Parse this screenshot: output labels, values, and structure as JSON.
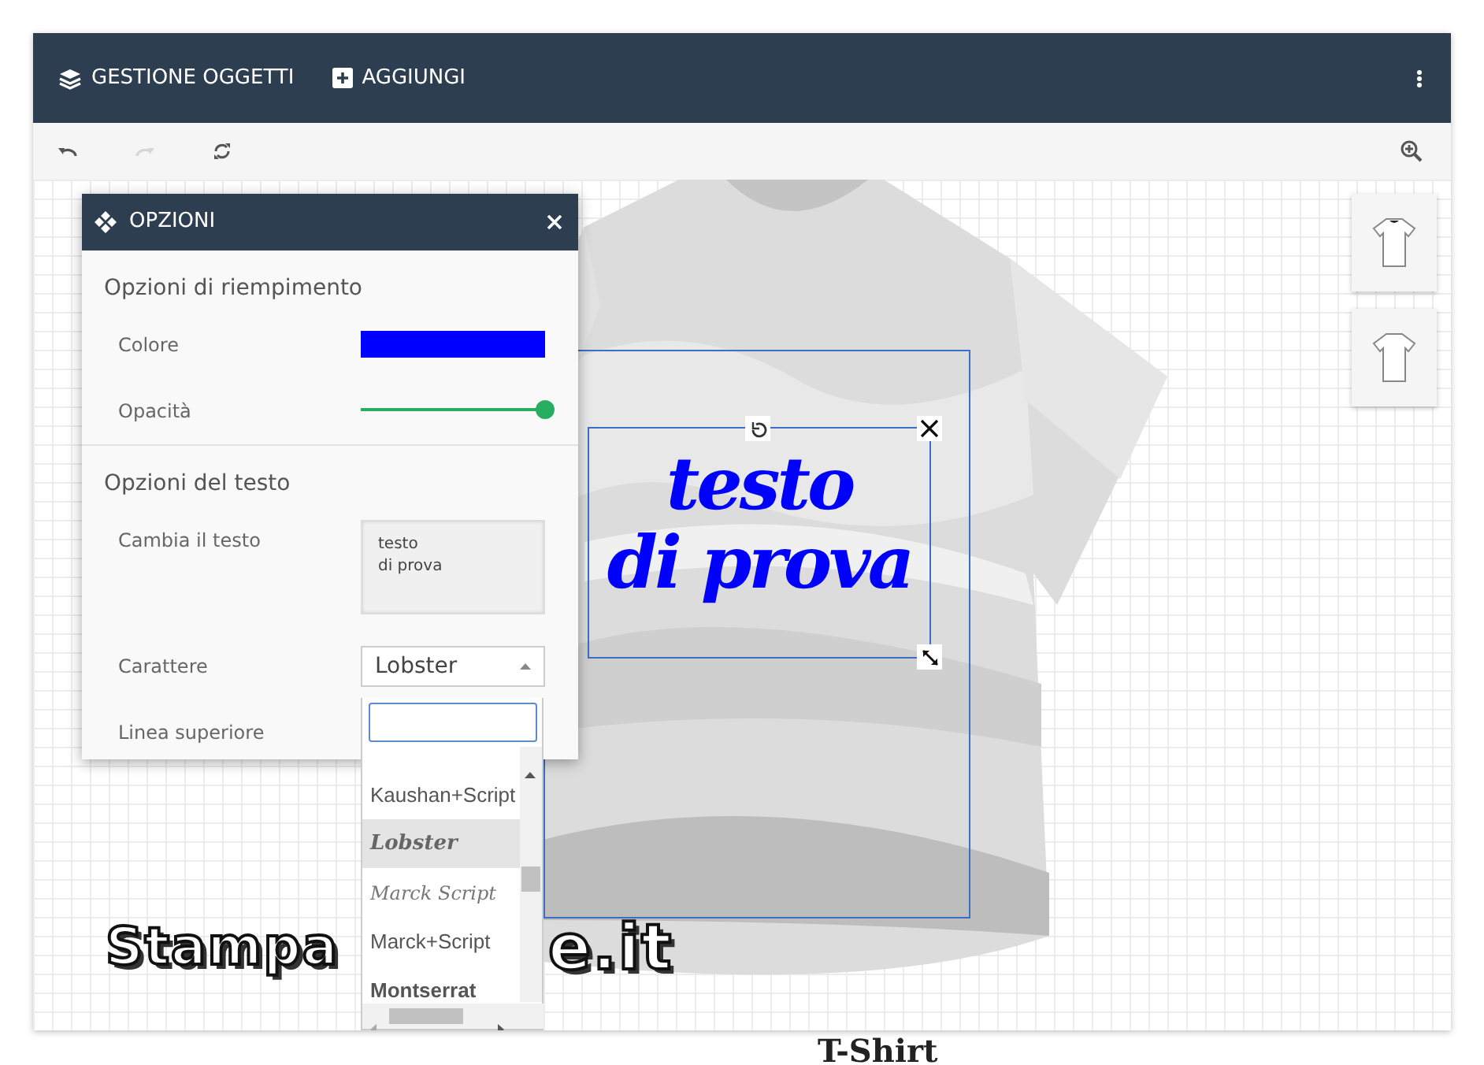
{
  "topbar": {
    "items": [
      {
        "kind": "layers",
        "label": "GESTIONE OGGETTI"
      },
      {
        "kind": "add",
        "label": "AGGIUNGI"
      }
    ]
  },
  "toolbar": {
    "tools": [
      {
        "kind": "undo",
        "disabled": false
      },
      {
        "kind": "redo",
        "disabled": true
      },
      {
        "kind": "reset",
        "disabled": false
      }
    ]
  },
  "options_panel": {
    "title": "OPZIONI",
    "sections": [
      {
        "heading": "Opzioni di riempimento",
        "rows": [
          {
            "kind": "color",
            "label": "Colore",
            "color": "#0000ff"
          },
          {
            "kind": "slider",
            "label": "Opacità",
            "level": 1
          }
        ]
      },
      {
        "heading": "Opzioni del testo",
        "rows": [
          {
            "kind": "textarea",
            "label": "Cambia il testo",
            "value": "testo\ndi prova"
          },
          {
            "kind": "select",
            "label": "Carattere",
            "value": "Lobster"
          },
          {
            "kind": "label",
            "label": "Linea superiore"
          }
        ]
      }
    ]
  },
  "font_dropdown": {
    "options": [
      {
        "label": "Kaushan+Script",
        "kind": "plain",
        "selected": false
      },
      {
        "label": "Lobster",
        "kind": "script",
        "selected": true
      },
      {
        "label": "Marck Script",
        "kind": "handwriting",
        "selected": false
      },
      {
        "label": "Marck+Script",
        "kind": "plain",
        "selected": false
      },
      {
        "label": "Montserrat",
        "kind": "bold",
        "selected": false
      }
    ]
  },
  "design": {
    "text": "testo\ndi prova"
  },
  "logo": [
    "Stampa",
    "e.it"
  ],
  "views": [
    {
      "kind": "front"
    },
    {
      "kind": "back"
    }
  ],
  "product_title": "T-Shirt"
}
